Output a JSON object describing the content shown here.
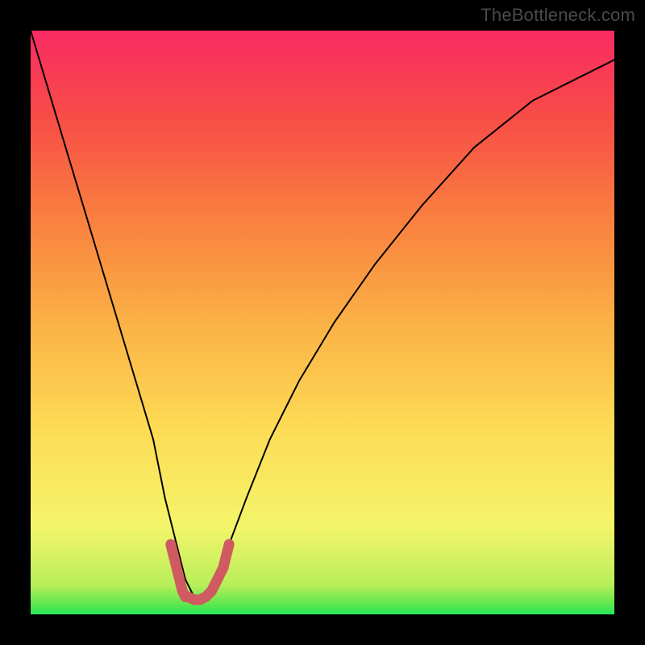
{
  "watermark": "TheBottleneck.com",
  "chart_data": {
    "type": "line",
    "title": "",
    "xlabel": "",
    "ylabel": "",
    "xlim": [
      0,
      100
    ],
    "ylim": [
      0,
      100
    ],
    "grid": false,
    "series": [
      {
        "name": "bottleneck-curve",
        "x": [
          0,
          3,
          6,
          9,
          12,
          15,
          18,
          21,
          23,
          25,
          26.5,
          28,
          30,
          32,
          34,
          37,
          41,
          46,
          52,
          59,
          67,
          76,
          86,
          100
        ],
        "y": [
          100,
          90,
          80,
          70,
          60,
          50,
          40,
          30,
          20,
          12,
          6,
          3,
          3,
          6,
          12,
          20,
          30,
          40,
          50,
          60,
          70,
          80,
          88,
          95
        ],
        "color": "#000000",
        "stroke_width": 2
      },
      {
        "name": "bottleneck-marker",
        "x": [
          24,
          25,
          25.5,
          26,
          26.5,
          27,
          28,
          29,
          30,
          31,
          32,
          33,
          33.5,
          34
        ],
        "y": [
          12,
          8,
          6,
          4,
          3,
          3,
          2.5,
          2.5,
          3,
          4,
          6,
          8,
          10,
          12
        ],
        "color": "#cf5a61",
        "stroke_width": 13
      }
    ],
    "annotations": []
  }
}
